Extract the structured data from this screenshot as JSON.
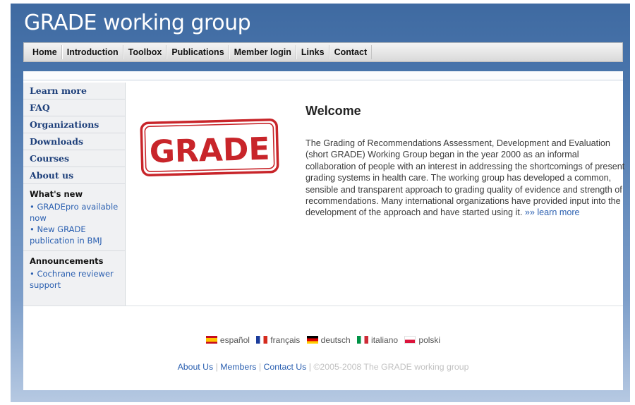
{
  "site": {
    "title": "GRADE working group"
  },
  "topnav": [
    "Home",
    "Introduction",
    "Toolbox",
    "Publications",
    "Member login",
    "Links",
    "Contact"
  ],
  "sidebar": {
    "menu": [
      "Learn more",
      "FAQ",
      "Organizations",
      "Downloads",
      "Courses",
      "About us"
    ],
    "whats_new": {
      "title": "What's new",
      "items": [
        "• GRADEpro available now",
        "• New GRADE publication in BMJ"
      ]
    },
    "announcements": {
      "title": "Announcements",
      "items": [
        "• Cochrane reviewer support"
      ]
    }
  },
  "main": {
    "logo_text": "GRADE",
    "heading": "Welcome",
    "intro": "The Grading of Recommendations Assessment, Development and Evaluation (short GRADE) Working Group began in the year 2000 as an informal collaboration of people with an interest in addressing the shortcomings of present grading systems in health care. The working group has developed a common, sensible and transparent approach to grading quality of evidence and strength of recommendations. Many international organizations have provided input into the development of the approach and have started using it.",
    "learn_more": "»» learn more"
  },
  "languages": [
    {
      "label": "español",
      "flag": "flag-spain-icon"
    },
    {
      "label": "français",
      "flag": "flag-france-icon"
    },
    {
      "label": "deutsch",
      "flag": "flag-germany-icon"
    },
    {
      "label": "italiano",
      "flag": "flag-italy-icon"
    },
    {
      "label": "polski",
      "flag": "flag-poland-icon"
    }
  ],
  "footer": {
    "about": "About Us",
    "members": "Members",
    "contact": "Contact Us",
    "separator": "|",
    "copyright": "©2005-2008 The GRADE working group"
  },
  "colors": {
    "header_blue": "#3f6aa1",
    "logo_red": "#c8252a",
    "link_blue": "#2a5fb0"
  }
}
